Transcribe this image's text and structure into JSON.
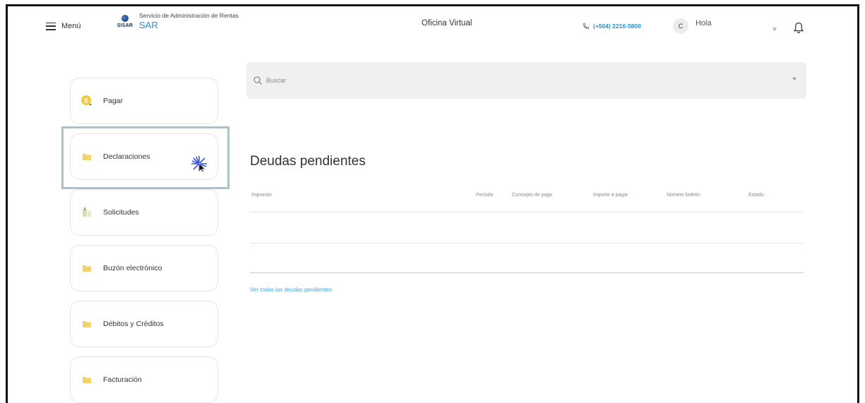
{
  "header": {
    "menu_label": "Menú",
    "brand_subtitle": "Servicio de Administración de Rentas",
    "brand_name": "SAR",
    "brand_logo_text": "SISAR",
    "center_title": "Oficina Virtual",
    "phone": "(+504) 2216-5800",
    "avatar_initial": "C",
    "greeting": "Hola"
  },
  "sidebar": {
    "items": [
      {
        "label": "Pagar"
      },
      {
        "label": "Declaraciones"
      },
      {
        "label": "Solicitudes"
      },
      {
        "label": "Buzón electrónico"
      },
      {
        "label": "Débitos y Créditos"
      },
      {
        "label": "Facturación"
      }
    ]
  },
  "search": {
    "placeholder": "Buscar"
  },
  "debts": {
    "title": "Deudas pendientes",
    "columns": [
      "Impuesto",
      "Período",
      "Concepto de pago",
      "Importe a pagar",
      "Número boletín",
      "Estado"
    ],
    "link_all": "Ver todas las deudas pendientes"
  },
  "colors": {
    "accent": "#2d8cd4",
    "link": "#4aa3df",
    "highlight_border": "#a5c4cb",
    "folder_yellow": "#f5d36a"
  }
}
